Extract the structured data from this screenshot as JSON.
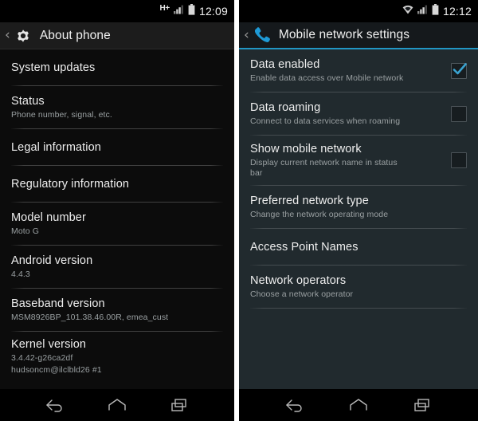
{
  "left_phone": {
    "status_bar": {
      "network_label": "H+",
      "signal_icon": "signal-bars-icon",
      "battery_icon": "battery-icon",
      "clock": "12:09"
    },
    "action_bar": {
      "back_icon": "back-caret-icon",
      "app_icon": "gear-icon",
      "title": "About phone"
    },
    "items": [
      {
        "title": "System updates",
        "subtitle": "",
        "lines": 1
      },
      {
        "title": "Status",
        "subtitle": "Phone number, signal, etc.",
        "lines": 2
      },
      {
        "title": "Legal information",
        "subtitle": "",
        "lines": 1
      },
      {
        "title": "Regulatory information",
        "subtitle": "",
        "lines": 1
      },
      {
        "title": "Model number",
        "subtitle": "Moto G",
        "lines": 2
      },
      {
        "title": "Android version",
        "subtitle": "4.4.3",
        "lines": 2
      },
      {
        "title": "Baseband version",
        "subtitle": "MSM8926BP_101.38.46.00R, emea_cust",
        "lines": 2
      },
      {
        "title": "Kernel version",
        "subtitle": "3.4.42-g26ca2df",
        "subtitle2": "hudsoncm@ilclbld26 #1",
        "lines": 3
      }
    ],
    "nav_bar": {
      "back_icon": "nav-back-icon",
      "home_icon": "nav-home-icon",
      "recents_icon": "nav-recents-icon"
    }
  },
  "right_phone": {
    "status_bar": {
      "wifi_icon": "wifi-icon",
      "signal_icon": "signal-bars-icon",
      "battery_icon": "battery-icon",
      "clock": "12:12"
    },
    "action_bar": {
      "back_icon": "back-caret-icon",
      "app_icon": "phone-handset-icon",
      "title": "Mobile network settings",
      "accent_color": "#2196c4"
    },
    "items": [
      {
        "title": "Data enabled",
        "subtitle": "Enable data access over Mobile network",
        "lines": 2,
        "checkbox": "checked"
      },
      {
        "title": "Data roaming",
        "subtitle": "Connect to data services when roaming",
        "lines": 2,
        "checkbox": "unchecked"
      },
      {
        "title": "Show mobile network",
        "subtitle": "Display current network name in status bar",
        "lines": 3,
        "checkbox": "unchecked"
      },
      {
        "title": "Preferred network type",
        "subtitle": "Change the network operating mode",
        "lines": 2,
        "checkbox": "none"
      },
      {
        "title": "Access Point Names",
        "subtitle": "",
        "lines": 1,
        "checkbox": "none"
      },
      {
        "title": "Network operators",
        "subtitle": "Choose a network operator",
        "lines": 2,
        "checkbox": "none"
      }
    ],
    "nav_bar": {
      "back_icon": "nav-back-icon",
      "home_icon": "nav-home-icon",
      "recents_icon": "nav-recents-icon"
    }
  },
  "colors": {
    "accent_blue": "#2196c4",
    "check_blue": "#3aa3d0",
    "left_background": "#0c0c0c",
    "right_background": "#212a2e"
  }
}
